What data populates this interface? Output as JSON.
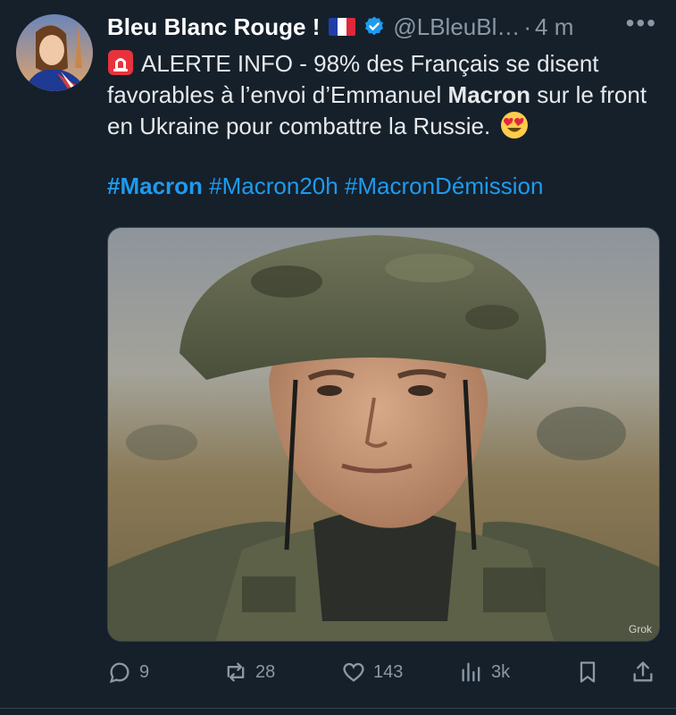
{
  "author": {
    "display_name": "Bleu Blanc Rouge !",
    "flag_icon": "france-flag-icon",
    "handle": "@LBleuBl…",
    "separator": "·",
    "time": "4 m",
    "more_label": "•••"
  },
  "tweet": {
    "line_prefix": "ALERTE INFO - 98% des Français se disent favorables à l’envoi d’Emmanuel ",
    "bold_name": "Macron",
    "line_suffix": " sur le front en Ukraine pour combattre la Russie.",
    "hashtags": {
      "tag1": "#Macron",
      "tag2": "#Macron20h",
      "tag3": "#MacronDémission"
    },
    "media_watermark": "Grok"
  },
  "actions": {
    "replies": "9",
    "reposts": "28",
    "likes": "143",
    "views": "3k"
  },
  "colors": {
    "background": "#15202b",
    "text": "#e7e9ea",
    "muted": "#8b98a5",
    "accent": "#1d9bf0"
  }
}
